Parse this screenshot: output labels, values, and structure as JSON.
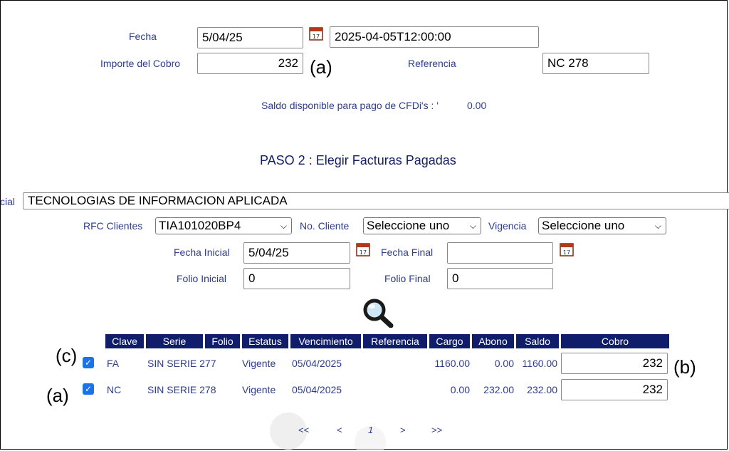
{
  "header": {
    "fecha_label": "Fecha",
    "fecha_value": "5/04/25",
    "fecha_iso": "2025-04-05T12:00:00",
    "importe_label": "Importe del Cobro",
    "importe_value": "232",
    "referencia_label": "Referencia",
    "referencia_value": "NC 278",
    "saldo_text": "Saldo disponible para pago de CFDi's : '",
    "saldo_value": "0.00"
  },
  "step2": {
    "title": "PASO 2 : Elegir Facturas Pagadas",
    "razon_label_partial": "cial",
    "razon_value": "TECNOLOGIAS DE INFORMACION APLICADA",
    "rfc_label": "RFC Clientes",
    "rfc_value": "TIA101020BP4",
    "nocliente_label": "No. Cliente",
    "nocliente_value": "Seleccione uno",
    "vigencia_label": "Vigencia",
    "vigencia_value": "Seleccione uno",
    "fecha_inicial_label": "Fecha Inicial",
    "fecha_inicial_value": "5/04/25",
    "fecha_final_label": "Fecha Final",
    "fecha_final_value": "",
    "folio_inicial_label": "Folio Inicial",
    "folio_inicial_value": "0",
    "folio_final_label": "Folio Final",
    "folio_final_value": "0"
  },
  "table": {
    "headers": [
      "Clave",
      "Serie",
      "Folio",
      "Estatus",
      "Vencimiento",
      "Referencia",
      "Cargo",
      "Abono",
      "Saldo",
      "Cobro"
    ],
    "rows": [
      {
        "clave": "FA",
        "serie_folio": "SIN SERIE 277",
        "estatus": "Vigente",
        "vencimiento": "05/04/2025",
        "referencia": "",
        "cargo": "1160.00",
        "abono": "0.00",
        "saldo": "1160.00",
        "cobro": "232",
        "checked": true
      },
      {
        "clave": "NC",
        "serie_folio": "SIN SERIE 278",
        "estatus": "Vigente",
        "vencimiento": "05/04/2025",
        "referencia": "",
        "cargo": "0.00",
        "abono": "232.00",
        "saldo": "232.00",
        "cobro": "232",
        "checked": true
      }
    ]
  },
  "pager": {
    "first": "<<",
    "prev": "<",
    "page": "1",
    "next": ">",
    "last": ">>"
  },
  "annotations": {
    "a_top": "(a)",
    "b": "(b)",
    "c": "(c)",
    "a_row": "(a)"
  },
  "colors": {
    "label": "#2e3c8c",
    "header_bg": "#101d6b",
    "checkbox": "#1a73e8"
  },
  "icons": {
    "calendar": "calendar-icon",
    "search": "magnifier-search-icon",
    "check": "checkmark-icon"
  }
}
